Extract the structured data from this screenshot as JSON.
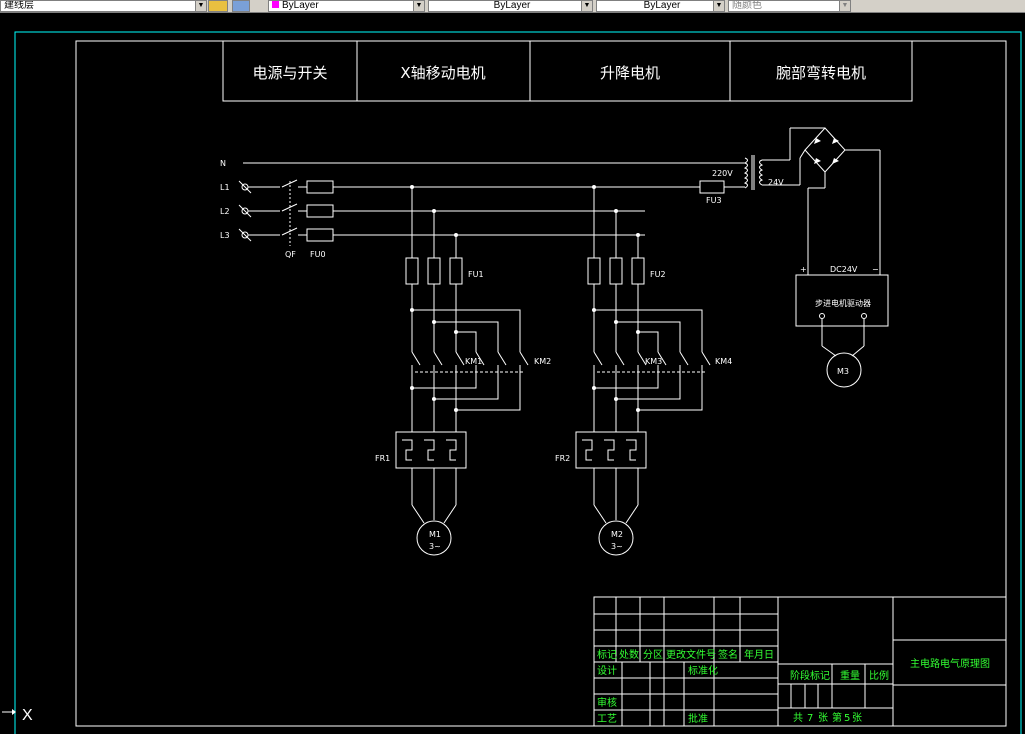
{
  "toolbar": {
    "layer_combo": "建线层",
    "color_combo": "ByLayer",
    "linetype_combo": "ByLayer",
    "lineweight_combo": "ByLayer",
    "plotstyle_combo": "随颜色"
  },
  "header_sections": [
    "电源与开关",
    "X轴移动电机",
    "升降电机",
    "腕部弯转电机"
  ],
  "power_lines": [
    "N",
    "L1",
    "L2",
    "L3"
  ],
  "components": {
    "breaker": "QF",
    "fuse_main": "FU0",
    "fuse_1": "FU1",
    "fuse_2": "FU2",
    "fuse_3": "FU3",
    "contactor_1": "KM1",
    "contactor_2": "KM2",
    "contactor_3": "KM3",
    "contactor_4": "KM4",
    "relay_1": "FR1",
    "relay_2": "FR2",
    "motor_1_name": "M1",
    "motor_1_phase": "3~",
    "motor_2_name": "M2",
    "motor_2_phase": "3~",
    "motor_3_name": "M3",
    "transformer_primary": "220V",
    "transformer_secondary": "24V",
    "dc_supply": "DC24V",
    "dc_plus": "+",
    "dc_minus": "−",
    "driver_label": "步进电机驱动器"
  },
  "title_block": {
    "row_headers": [
      "标记",
      "处数",
      "分区",
      "更改文件号",
      "签名",
      "年月日"
    ],
    "design": "设计",
    "standardization": "标准化",
    "review": "审核",
    "process": "工艺",
    "approval": "批准",
    "stage_mark": "阶段标记",
    "weight": "重量",
    "scale": "比例",
    "total_label": "共",
    "total_sheets": "7",
    "sheet_unit": "张",
    "sheet_label": "第",
    "sheet_number": "5",
    "sheet_unit2": "张",
    "drawing_title": "主电路电气原理图"
  },
  "ucs_icon_letter": "X"
}
